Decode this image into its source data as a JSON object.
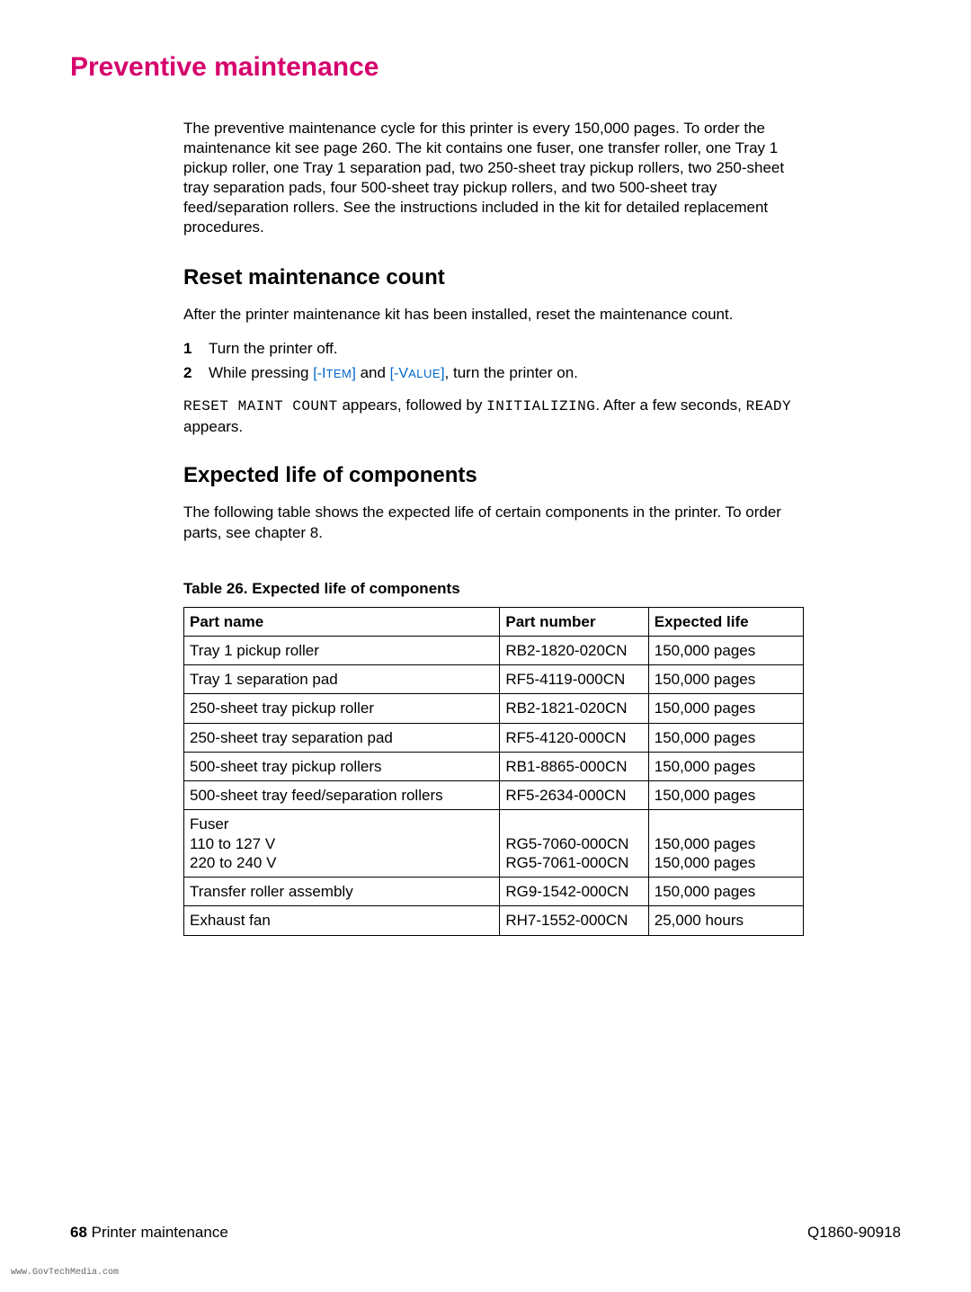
{
  "title": "Preventive maintenance",
  "intro": "The preventive maintenance cycle for this printer is every 150,000 pages. To order the maintenance kit see page 260. The kit contains one fuser, one transfer roller, one Tray 1 pickup roller, one Tray 1 separation pad, two 250-sheet tray pickup rollers, two 250-sheet tray separation pads, four 500-sheet tray pickup rollers, and two 500-sheet tray feed/separation rollers. See the instructions included in the kit for detailed replacement procedures.",
  "section1": {
    "heading": "Reset maintenance count",
    "lead": "After the printer maintenance kit has been installed, reset the maintenance count.",
    "steps": {
      "n1": "1",
      "t1": "Turn the printer off.",
      "n2": "2",
      "t2a": "While pressing ",
      "key1_open": "[-I",
      "key1_sc": "TEM",
      "key1_close": "]",
      "t2b": " and ",
      "key2_open": "[-V",
      "key2_sc": "ALUE",
      "key2_close": "]",
      "t2c": ", turn the printer on."
    },
    "result": {
      "lcd1": "RESET MAINT COUNT",
      "mid1": " appears, followed by ",
      "lcd2": "INITIALIZING",
      "mid2": ". After a few seconds, ",
      "lcd3": "READY",
      "mid3": " appears."
    }
  },
  "section2": {
    "heading": "Expected life of components",
    "lead": "The following table shows the expected life of certain components in the printer. To order parts, see chapter 8."
  },
  "table": {
    "caption": "Table 26. Expected life of components",
    "headers": {
      "c1": "Part name",
      "c2": "Part number",
      "c3": "Expected life"
    },
    "rows": [
      {
        "name": "Tray 1 pickup roller",
        "num": "RB2-1820-020CN",
        "life": "150,000 pages"
      },
      {
        "name": "Tray 1 separation pad",
        "num": "RF5-4119-000CN",
        "life": "150,000 pages"
      },
      {
        "name": "250-sheet tray pickup roller",
        "num": "RB2-1821-020CN",
        "life": "150,000 pages"
      },
      {
        "name": "250-sheet tray separation pad",
        "num": "RF5-4120-000CN",
        "life": "150,000 pages"
      },
      {
        "name": "500-sheet tray pickup rollers",
        "num": "RB1-8865-000CN",
        "life": "150,000 pages"
      },
      {
        "name": "500-sheet tray feed/separation rollers",
        "num": "RF5-2634-000CN",
        "life": "150,000 pages"
      },
      {
        "name": "Fuser\n110 to 127 V\n220 to 240 V",
        "num": "\nRG5-7060-000CN\nRG5-7061-000CN",
        "life": "\n150,000 pages\n150,000 pages"
      },
      {
        "name": "Transfer roller assembly",
        "num": "RG9-1542-000CN",
        "life": "150,000 pages"
      },
      {
        "name": "Exhaust fan",
        "num": "RH7-1552-000CN",
        "life": "25,000 hours"
      }
    ]
  },
  "footer": {
    "page": "68",
    "section": " Printer maintenance",
    "docnum": "Q1860-90918"
  },
  "watermark": "www.GovTechMedia.com"
}
